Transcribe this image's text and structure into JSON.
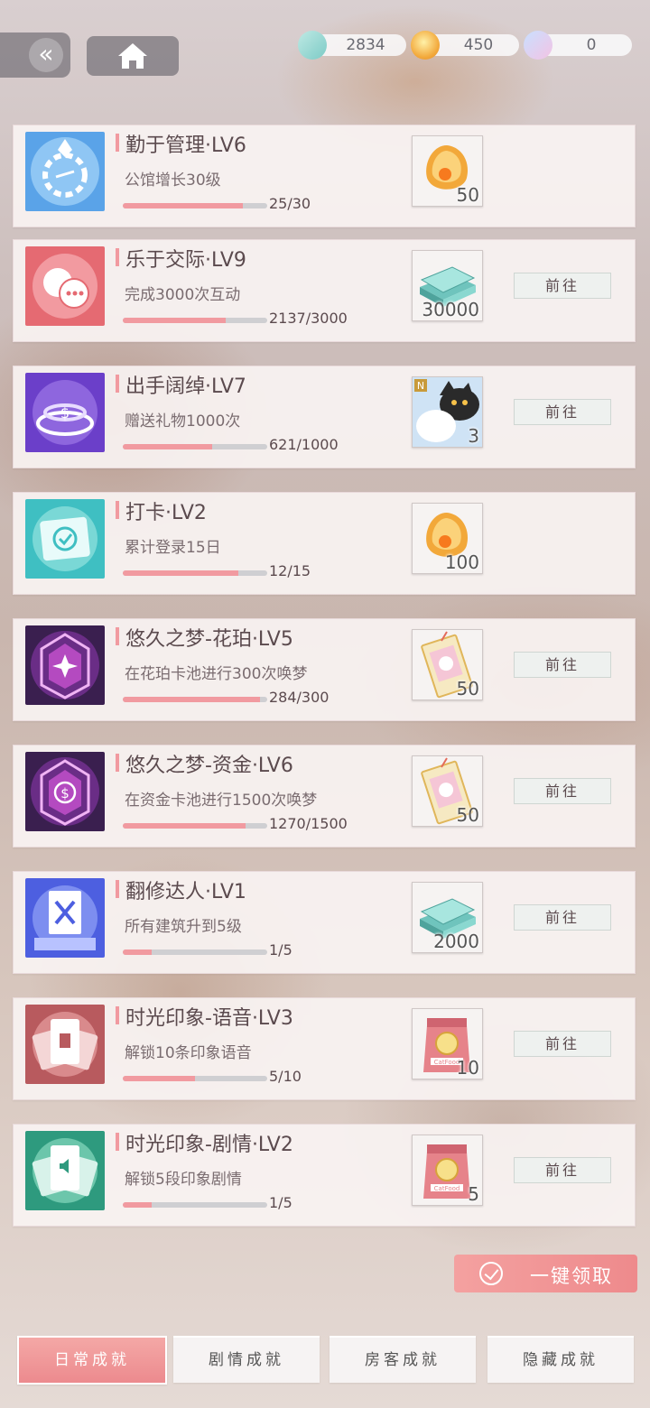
{
  "header": {
    "back_icon": "double-chevron-left",
    "home_icon": "house",
    "currencies": [
      {
        "icon": "cash-stack-icon",
        "value": "2834"
      },
      {
        "icon": "amber-gem-icon",
        "value": "450"
      },
      {
        "icon": "crystal-feather-icon",
        "value": "0"
      }
    ]
  },
  "achievements": [
    {
      "title": "勤于管理·LV6",
      "desc": "公馆增长30级",
      "progress": "25/30",
      "current": 25,
      "target": 30,
      "reward_icon": "amber-gem",
      "reward_count": "50",
      "goto_label": ""
    },
    {
      "title": "乐于交际·LV9",
      "desc": "完成3000次互动",
      "progress": "2137/3000",
      "current": 2137,
      "target": 3000,
      "reward_icon": "cash-stack",
      "reward_count": "30000",
      "goto_label": "前往"
    },
    {
      "title": "出手阔绰·LV7",
      "desc": "赠送礼物1000次",
      "progress": "621/1000",
      "current": 621,
      "target": 1000,
      "reward_icon": "cat-card",
      "reward_count": "3",
      "goto_label": "前往"
    },
    {
      "title": "打卡·LV2",
      "desc": "累计登录15日",
      "progress": "12/15",
      "current": 12,
      "target": 15,
      "reward_icon": "amber-gem",
      "reward_count": "100",
      "goto_label": ""
    },
    {
      "title": "悠久之梦-花珀·LV5",
      "desc": "在花珀卡池进行300次唤梦",
      "progress": "284/300",
      "current": 284,
      "target": 300,
      "reward_icon": "dream-ticket",
      "reward_count": "50",
      "goto_label": "前往"
    },
    {
      "title": "悠久之梦-资金·LV6",
      "desc": "在资金卡池进行1500次唤梦",
      "progress": "1270/1500",
      "current": 1270,
      "target": 1500,
      "reward_icon": "dream-ticket",
      "reward_count": "50",
      "goto_label": "前往"
    },
    {
      "title": "翻修达人·LV1",
      "desc": "所有建筑升到5级",
      "progress": "1/5",
      "current": 1,
      "target": 5,
      "reward_icon": "cash-stack",
      "reward_count": "2000",
      "goto_label": "前往"
    },
    {
      "title": "时光印象-语音·LV3",
      "desc": "解锁10条印象语音",
      "progress": "5/10",
      "current": 5,
      "target": 10,
      "reward_icon": "cat-food-bag",
      "reward_count": "10",
      "goto_label": "前往"
    },
    {
      "title": "时光印象-剧情·LV2",
      "desc": "解锁5段印象剧情",
      "progress": "1/5",
      "current": 1,
      "target": 5,
      "reward_icon": "cat-food-bag",
      "reward_count": "5",
      "goto_label": "前往"
    }
  ],
  "claim_all_label": "一键领取",
  "tabs": [
    {
      "label": "日常成就",
      "active": true
    },
    {
      "label": "剧情成就",
      "active": false
    },
    {
      "label": "房客成就",
      "active": false
    },
    {
      "label": "隐藏成就",
      "active": false
    }
  ],
  "colors": {
    "accent": "#f19aa0",
    "tab_active": "#ec8a8e"
  }
}
